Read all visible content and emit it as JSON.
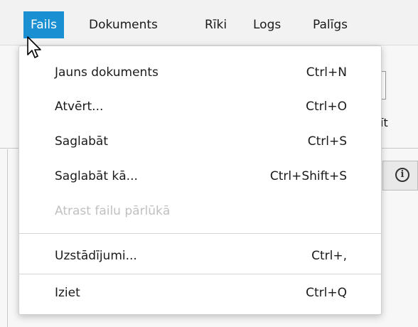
{
  "menubar": {
    "items": [
      {
        "label": "Fails",
        "active": true
      },
      {
        "label": "Dokuments"
      },
      {
        "label": "Rīki"
      },
      {
        "label": "Logs"
      },
      {
        "label": "Palīgs"
      }
    ]
  },
  "file_menu": {
    "items": [
      {
        "label": "Jauns dokuments",
        "shortcut": "Ctrl+N"
      },
      {
        "label": "Atvērt...",
        "shortcut": "Ctrl+O"
      },
      {
        "label": "Saglabāt",
        "shortcut": "Ctrl+S"
      },
      {
        "label": "Saglabāt kā...",
        "shortcut": "Ctrl+Shift+S"
      },
      {
        "label": "Atrast failu pārlūkā",
        "shortcut": "",
        "disabled": true
      },
      {
        "label": "Uzstādījumi...",
        "shortcut": "Ctrl+,"
      },
      {
        "label": "Iziet",
        "shortcut": "Ctrl+Q"
      }
    ]
  },
  "background": {
    "partial_text": "īt",
    "info_icon_glyph": "i"
  },
  "colors": {
    "accent": "#1a8fd1",
    "disabled_text": "#c0c0c0"
  }
}
